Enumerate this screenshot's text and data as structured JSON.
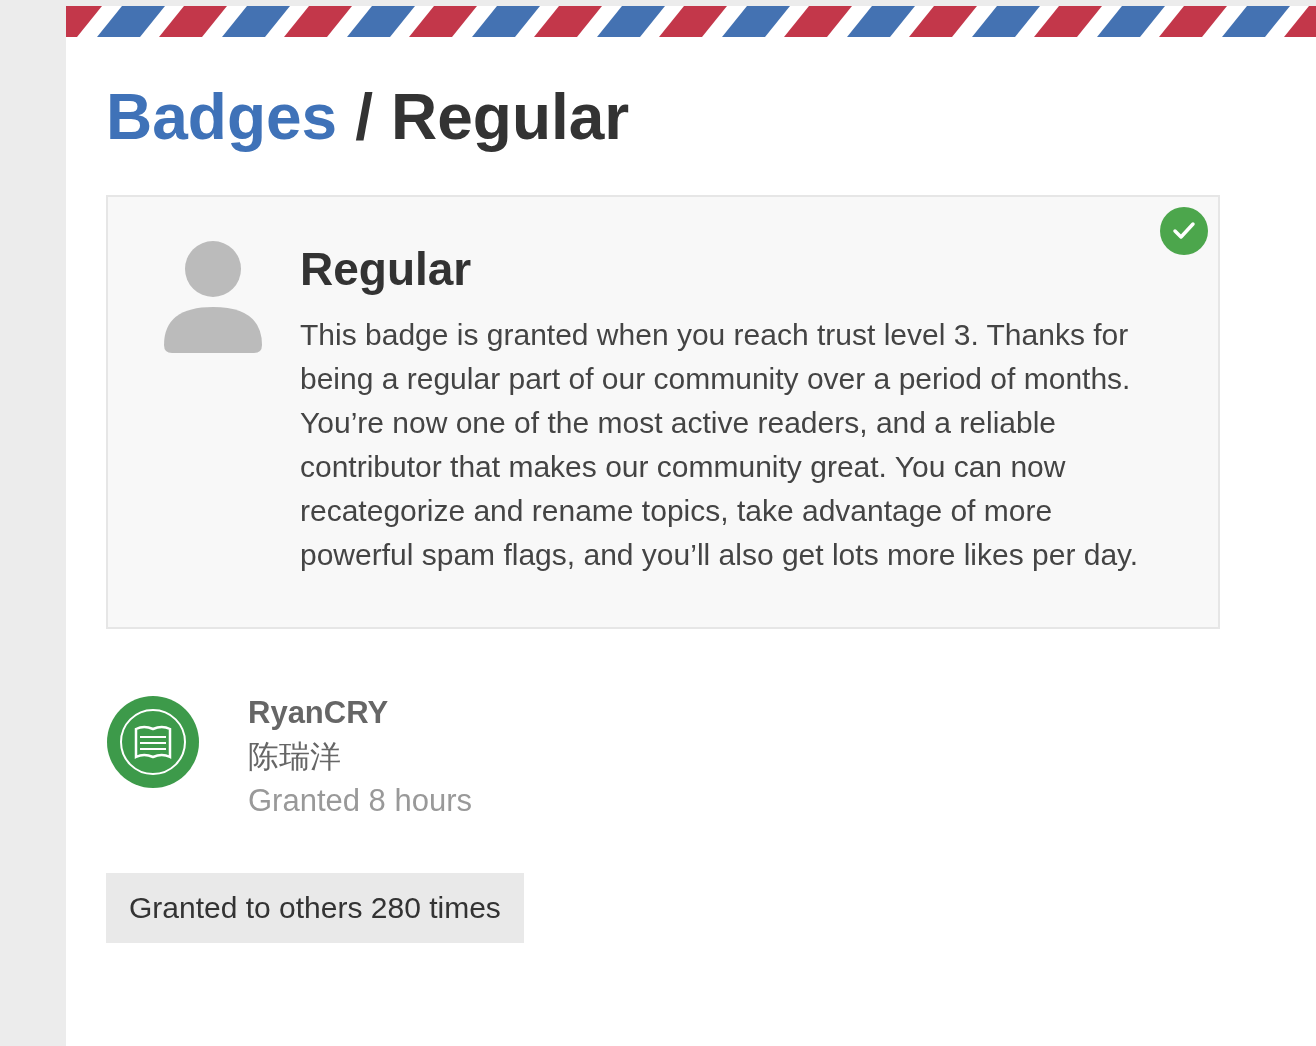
{
  "breadcrumb": {
    "parent": "Badges",
    "separator": "/",
    "current": "Regular"
  },
  "badge": {
    "title": "Regular",
    "granted": true,
    "description": "This badge is granted when you reach trust level 3. Thanks for being a regular part of our community over a period of months. You’re now one of the most active readers, and a reliable contributor that makes our community great. You can now recategorize and rename topics, take advantage of more powerful spam flags, and you’ll also get lots more likes per day."
  },
  "grant": {
    "username": "RyanCRY",
    "name": "陈瑞洋",
    "time": "Granted 8 hours"
  },
  "others_button": "Granted to others 280 times"
}
